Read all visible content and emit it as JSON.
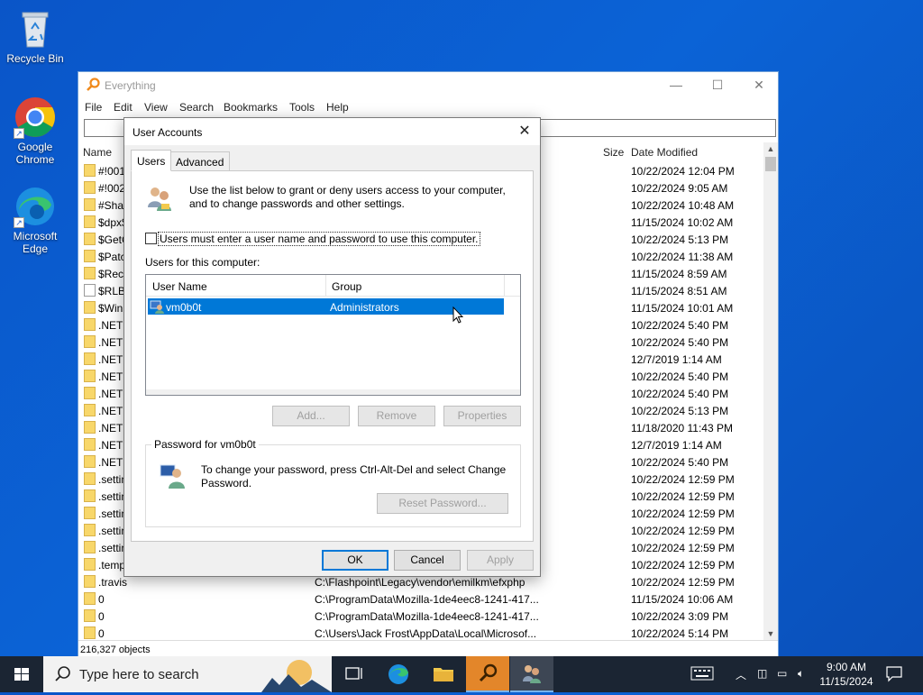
{
  "desktop": {
    "icons": [
      {
        "label": "Recycle Bin"
      },
      {
        "label": "Google Chrome"
      },
      {
        "label": "Microsoft Edge"
      }
    ]
  },
  "everything": {
    "title": "Everything",
    "menu": [
      "File",
      "Edit",
      "View",
      "Search",
      "Bookmarks",
      "Tools",
      "Help"
    ],
    "search_value": "",
    "columns": {
      "name": "Name",
      "size": "Size",
      "date": "Date Modified"
    },
    "rows": [
      {
        "name": "#!001",
        "path": "",
        "date": "10/22/2024 12:04 PM",
        "icon": "folder"
      },
      {
        "name": "#!002",
        "path": "",
        "date": "10/22/2024 9:05 AM",
        "icon": "folder"
      },
      {
        "name": "#Shar",
        "path": "",
        "date": "10/22/2024 10:48 AM",
        "icon": "folder"
      },
      {
        "name": "$dpx$",
        "path": "",
        "date": "11/15/2024 10:02 AM",
        "icon": "folder"
      },
      {
        "name": "$GetC",
        "path": "",
        "date": "10/22/2024 5:13 PM",
        "icon": "folder"
      },
      {
        "name": "$Patc",
        "path": "",
        "date": "10/22/2024 11:38 AM",
        "icon": "folder"
      },
      {
        "name": "$Recy",
        "path": "",
        "date": "11/15/2024 8:59 AM",
        "icon": "folder"
      },
      {
        "name": "$RLBI",
        "path": "",
        "date": "11/15/2024 8:51 AM",
        "icon": "file"
      },
      {
        "name": "$WinI",
        "path": "",
        "date": "11/15/2024 10:01 AM",
        "icon": "folder"
      },
      {
        "name": ".NET C",
        "path": "",
        "date": "10/22/2024 5:40 PM",
        "icon": "folder"
      },
      {
        "name": ".NET C",
        "path": "",
        "date": "10/22/2024 5:40 PM",
        "icon": "folder"
      },
      {
        "name": ".NET C",
        "path": "",
        "date": "12/7/2019 1:14 AM",
        "icon": "folder"
      },
      {
        "name": ".NET D",
        "path": "",
        "date": "10/22/2024 5:40 PM",
        "icon": "folder"
      },
      {
        "name": ".NET D",
        "path": "",
        "date": "10/22/2024 5:40 PM",
        "icon": "folder"
      },
      {
        "name": ".NET F",
        "path": "",
        "date": "10/22/2024 5:13 PM",
        "icon": "folder"
      },
      {
        "name": ".NET F",
        "path": "",
        "date": "11/18/2020 11:43 PM",
        "icon": "folder"
      },
      {
        "name": ".NET I",
        "path": "",
        "date": "12/7/2019 1:14 AM",
        "icon": "folder"
      },
      {
        "name": ".NETF",
        "path": "",
        "date": "10/22/2024 5:40 PM",
        "icon": "folder"
      },
      {
        "name": ".settin",
        "path": "",
        "date": "10/22/2024 12:59 PM",
        "icon": "folder"
      },
      {
        "name": ".settin",
        "path": "",
        "date": "10/22/2024 12:59 PM",
        "icon": "folder"
      },
      {
        "name": ".settin",
        "path": "",
        "date": "10/22/2024 12:59 PM",
        "icon": "folder"
      },
      {
        "name": ".settin",
        "path": "",
        "date": "10/22/2024 12:59 PM",
        "icon": "folder"
      },
      {
        "name": ".settin",
        "path": "",
        "date": "10/22/2024 12:59 PM",
        "icon": "folder"
      },
      {
        "name": ".temp",
        "path": "",
        "date": "10/22/2024 12:59 PM",
        "icon": "folder"
      },
      {
        "name": ".travis",
        "path": "C:\\Flashpoint\\Legacy\\vendor\\emilkm\\efxphp",
        "date": "10/22/2024 12:59 PM",
        "icon": "folder"
      },
      {
        "name": "0",
        "path": "C:\\ProgramData\\Mozilla-1de4eec8-1241-417...",
        "date": "11/15/2024 10:06 AM",
        "icon": "folder"
      },
      {
        "name": "0",
        "path": "C:\\ProgramData\\Mozilla-1de4eec8-1241-417...",
        "date": "10/22/2024 3:09 PM",
        "icon": "folder"
      },
      {
        "name": "0",
        "path": "C:\\Users\\Jack Frost\\AppData\\Local\\Microsof...",
        "date": "10/22/2024 5:14 PM",
        "icon": "folder"
      }
    ],
    "status": "216,327 objects"
  },
  "dialog": {
    "title": "User Accounts",
    "tabs": [
      "Users",
      "Advanced"
    ],
    "intro": "Use the list below to grant or deny users access to your computer, and to change passwords and other settings.",
    "checkbox_label": "Users must enter a user name and password to use this computer.",
    "users_label": "Users for this computer:",
    "columns": {
      "user": "User Name",
      "group": "Group"
    },
    "users": [
      {
        "name": "vm0b0t",
        "group": "Administrators"
      }
    ],
    "buttons": {
      "add": "Add...",
      "remove": "Remove",
      "properties": "Properties"
    },
    "password_group": "Password for vm0b0t",
    "password_text": "To change your password, press Ctrl-Alt-Del and select Change Password.",
    "reset_button": "Reset Password...",
    "footer": {
      "ok": "OK",
      "cancel": "Cancel",
      "apply": "Apply"
    }
  },
  "taskbar": {
    "search_placeholder": "Type here to search",
    "time": "9:00 AM",
    "date": "11/15/2024"
  },
  "colors": {
    "accent": "#0078d7",
    "desktop": "#0b63d6",
    "taskbar": "#1b2533"
  }
}
